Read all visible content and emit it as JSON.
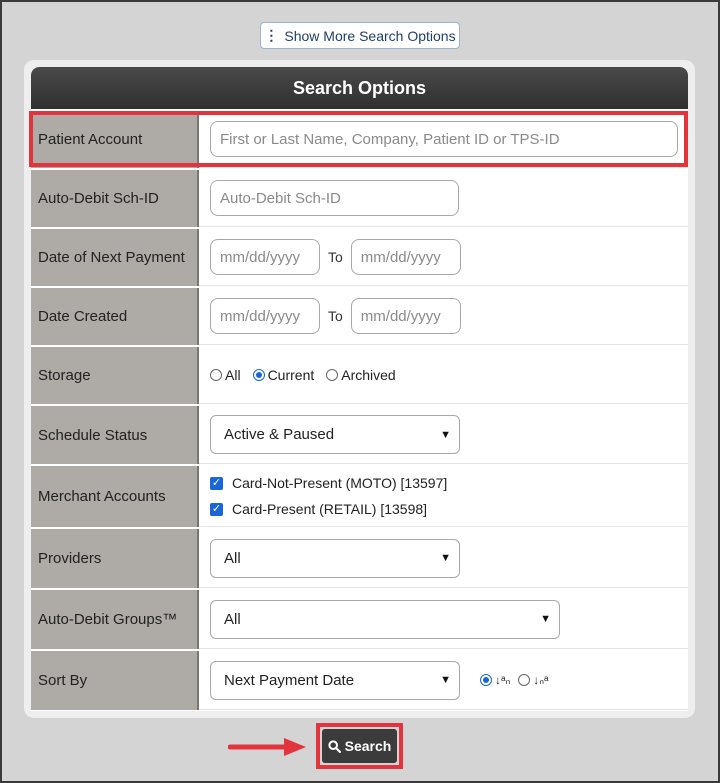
{
  "top_button": {
    "icon": "vertical-dots-icon",
    "label": "Show More Search Options"
  },
  "panel": {
    "title": "Search Options"
  },
  "rows": {
    "patient_account": {
      "label": "Patient Account",
      "placeholder": "First or Last Name, Company, Patient ID or TPS-ID"
    },
    "auto_debit_id": {
      "label": "Auto-Debit Sch-ID",
      "placeholder": "Auto-Debit Sch-ID"
    },
    "next_payment": {
      "label": "Date of Next Payment",
      "from_placeholder": "mm/dd/yyyy",
      "to_label": "To",
      "to_placeholder": "mm/dd/yyyy"
    },
    "date_created": {
      "label": "Date Created",
      "from_placeholder": "mm/dd/yyyy",
      "to_label": "To",
      "to_placeholder": "mm/dd/yyyy"
    },
    "storage": {
      "label": "Storage",
      "options": [
        "All",
        "Current",
        "Archived"
      ],
      "selected": "Current"
    },
    "schedule_status": {
      "label": "Schedule Status",
      "value": "Active & Paused"
    },
    "merchant_accounts": {
      "label": "Merchant Accounts",
      "items": [
        "Card-Not-Present (MOTO) [13597]",
        "Card-Present (RETAIL) [13598]"
      ]
    },
    "providers": {
      "label": "Providers",
      "value": "All"
    },
    "groups": {
      "label": "Auto-Debit Groups™",
      "value": "All"
    },
    "sort_by": {
      "label": "Sort By",
      "value": "Next Payment Date",
      "asc_icon": "sort-ascending-icon",
      "desc_icon": "sort-descending-icon",
      "selected": "asc"
    }
  },
  "search_button": {
    "icon": "magnifier-icon",
    "label": "Search"
  },
  "colors": {
    "highlight": "#e3343d",
    "accent": "#1a66d8",
    "header": "#3a3a3a"
  }
}
